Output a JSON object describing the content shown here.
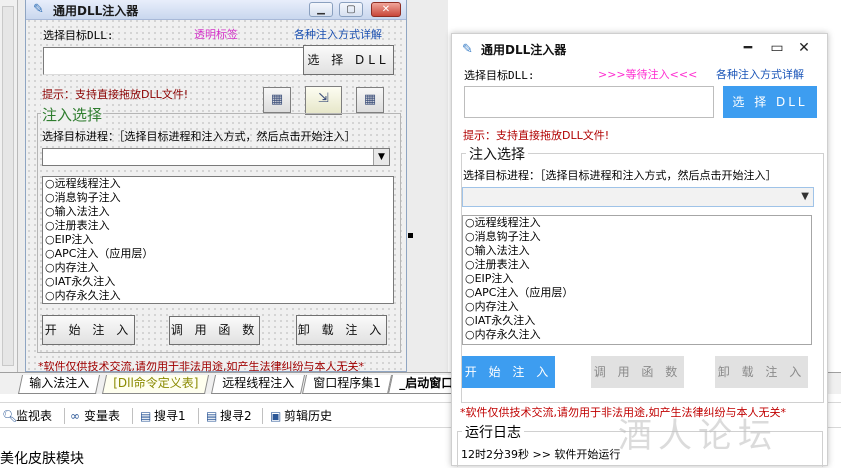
{
  "designer": {
    "title": "通用DLL注入器",
    "label_select_dll": "选择目标DLL:",
    "transparent_label": "透明标签",
    "link_methods": "各种注入方式详解",
    "btn_select_dll": "选 择 DLL",
    "tip": "提示：支持直接拖放DLL文件!",
    "group_title": "注入选择",
    "label_select_process": "选择目标进程：［选择目标进程和注入方式，然后点击开始注入］",
    "methods": [
      "○远程线程注入",
      "○消息钩子注入",
      "○输入法注入",
      "○注册表注入",
      "○EIP注入",
      "○APC注入（应用层）",
      "○内存注入",
      "○IAT永久注入",
      "○内存永久注入"
    ],
    "btn_start": "开 始 注 入",
    "btn_call": "调 用 函 数",
    "btn_unload": "卸 载 注 入",
    "warning": "*软件仅供技术交流,请勿用于非法用途,如产生法律纠纷与本人无关*"
  },
  "tabs": [
    {
      "label": "输入法注入"
    },
    {
      "label": "[Dll命令定义表]"
    },
    {
      "label": "远程线程注入"
    },
    {
      "label": "窗口程序集1"
    },
    {
      "label": "_启动窗口"
    }
  ],
  "toolbar": {
    "items": [
      {
        "label": "监视表",
        "icon": "magnifier-icon"
      },
      {
        "label": "变量表",
        "icon": "variables-icon"
      },
      {
        "label": "搜寻1",
        "icon": "search1-icon"
      },
      {
        "label": "搜寻2",
        "icon": "search2-icon"
      },
      {
        "label": "剪辑历史",
        "icon": "clipboard-icon"
      }
    ]
  },
  "status_text": "美化皮肤模块",
  "app": {
    "title": "通用DLL注入器",
    "label_select_dll": "选择目标DLL:",
    "status": ">>>等待注入<<<",
    "link_methods": "各种注入方式详解",
    "btn_select_dll": "选 择 DLL",
    "tip": "提示：支持直接拖放DLL文件!",
    "group_title": "注入选择",
    "label_select_process": "选择目标进程：［选择目标进程和注入方式，然后点击开始注入］",
    "methods": [
      "○远程线程注入",
      "○消息钩子注入",
      "○输入法注入",
      "○注册表注入",
      "○EIP注入",
      "○APC注入（应用层）",
      "○内存注入",
      "○IAT永久注入",
      "○内存永久注入"
    ],
    "btn_start": "开 始 注 入",
    "btn_call": "调 用 函 数",
    "btn_unload": "卸 载 注 入",
    "warning": "*软件仅供技术交流,请勿用于非法用途,如产生法律纠纷与本人无关*",
    "log_title": "运行日志",
    "log_line": "12时2分39秒 >> 软件开始运行",
    "colors": {
      "primary": "#3d9df0",
      "status": "#ff2bd0",
      "link": "#1a55b8",
      "warning": "#c00000"
    }
  },
  "watermark": "酒人论坛"
}
